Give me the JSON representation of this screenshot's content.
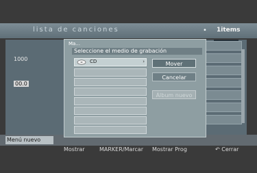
{
  "header": {
    "title": "lista de canciones",
    "count": "1items"
  },
  "background": {
    "row1_label": "1000",
    "row2_label": "00.0",
    "button_strip_label": "Menú nuevo"
  },
  "footer": {
    "items": [
      "Mostrar",
      "MARKER/Marcar",
      "Mostrar Prog",
      "Cerrar"
    ]
  },
  "dialog": {
    "caption": "Ma...",
    "title": "Seleccione el medio de grabación",
    "selected_label": "CD",
    "buttons": {
      "move": "Mover",
      "cancel": "Cancelar",
      "new_album": "Álbum nuevo"
    }
  },
  "colors": {
    "header_bar": "#6f7f88",
    "dialog_bg": "#8e9ea2",
    "button_active": "#5f7177"
  },
  "icons": {
    "disc": "disc-icon",
    "close": "close-icon"
  }
}
